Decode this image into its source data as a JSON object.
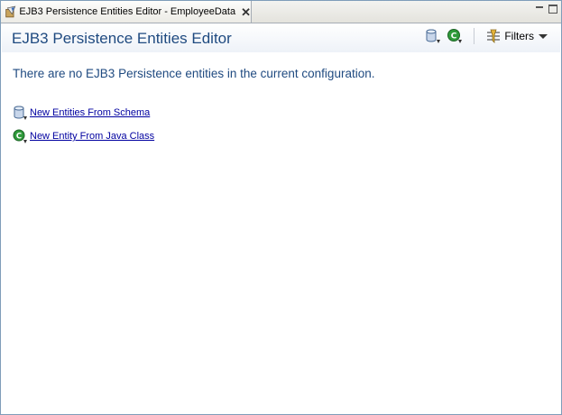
{
  "tab": {
    "title": "EJB3 Persistence Entities Editor - EmployeeData",
    "close_glyph": "✕"
  },
  "header": {
    "title": "EJB3 Persistence Entities Editor",
    "filters_label": "Filters",
    "tools": [
      "database-add-icon",
      "class-add-icon",
      "filter-icon"
    ]
  },
  "main": {
    "message": "There are no EJB3 Persistence entities in the current configuration.",
    "links": [
      {
        "label": "New Entities From Schema",
        "icon": "database-add-icon"
      },
      {
        "label": "New Entity From Java Class",
        "icon": "class-add-icon"
      }
    ]
  },
  "colors": {
    "title": "#1f4a80",
    "link": "#0000a0",
    "border": "#7f9db9",
    "green_icon": "#2f9a3a"
  }
}
